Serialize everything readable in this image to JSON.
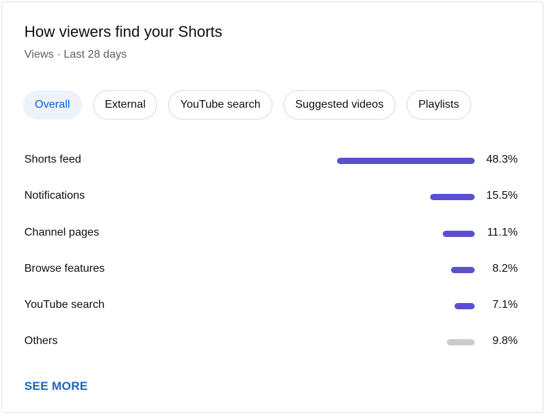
{
  "header": {
    "title": "How viewers find your Shorts",
    "subtitle": "Views · Last 28 days"
  },
  "filters": {
    "selected": "Overall",
    "chips": [
      {
        "label": "Overall"
      },
      {
        "label": "External"
      },
      {
        "label": "YouTube search"
      },
      {
        "label": "Suggested videos"
      },
      {
        "label": "Playlists"
      }
    ]
  },
  "colors": {
    "bar_primary": "#5a4fcf",
    "bar_other": "#cccccc",
    "link": "#1a66c2",
    "chip_selected_bg": "#eef3fb"
  },
  "chart_data": {
    "type": "bar",
    "orientation": "horizontal",
    "categories": [
      "Shorts feed",
      "Notifications",
      "Channel pages",
      "Browse features",
      "YouTube search",
      "Others"
    ],
    "values": [
      48.3,
      15.5,
      11.1,
      8.2,
      7.1,
      9.8
    ],
    "value_labels": [
      "48.3%",
      "15.5%",
      "11.1%",
      "8.2%",
      "7.1%",
      "9.8%"
    ],
    "unit": "%"
  },
  "footer": {
    "see_more_label": "SEE MORE"
  }
}
